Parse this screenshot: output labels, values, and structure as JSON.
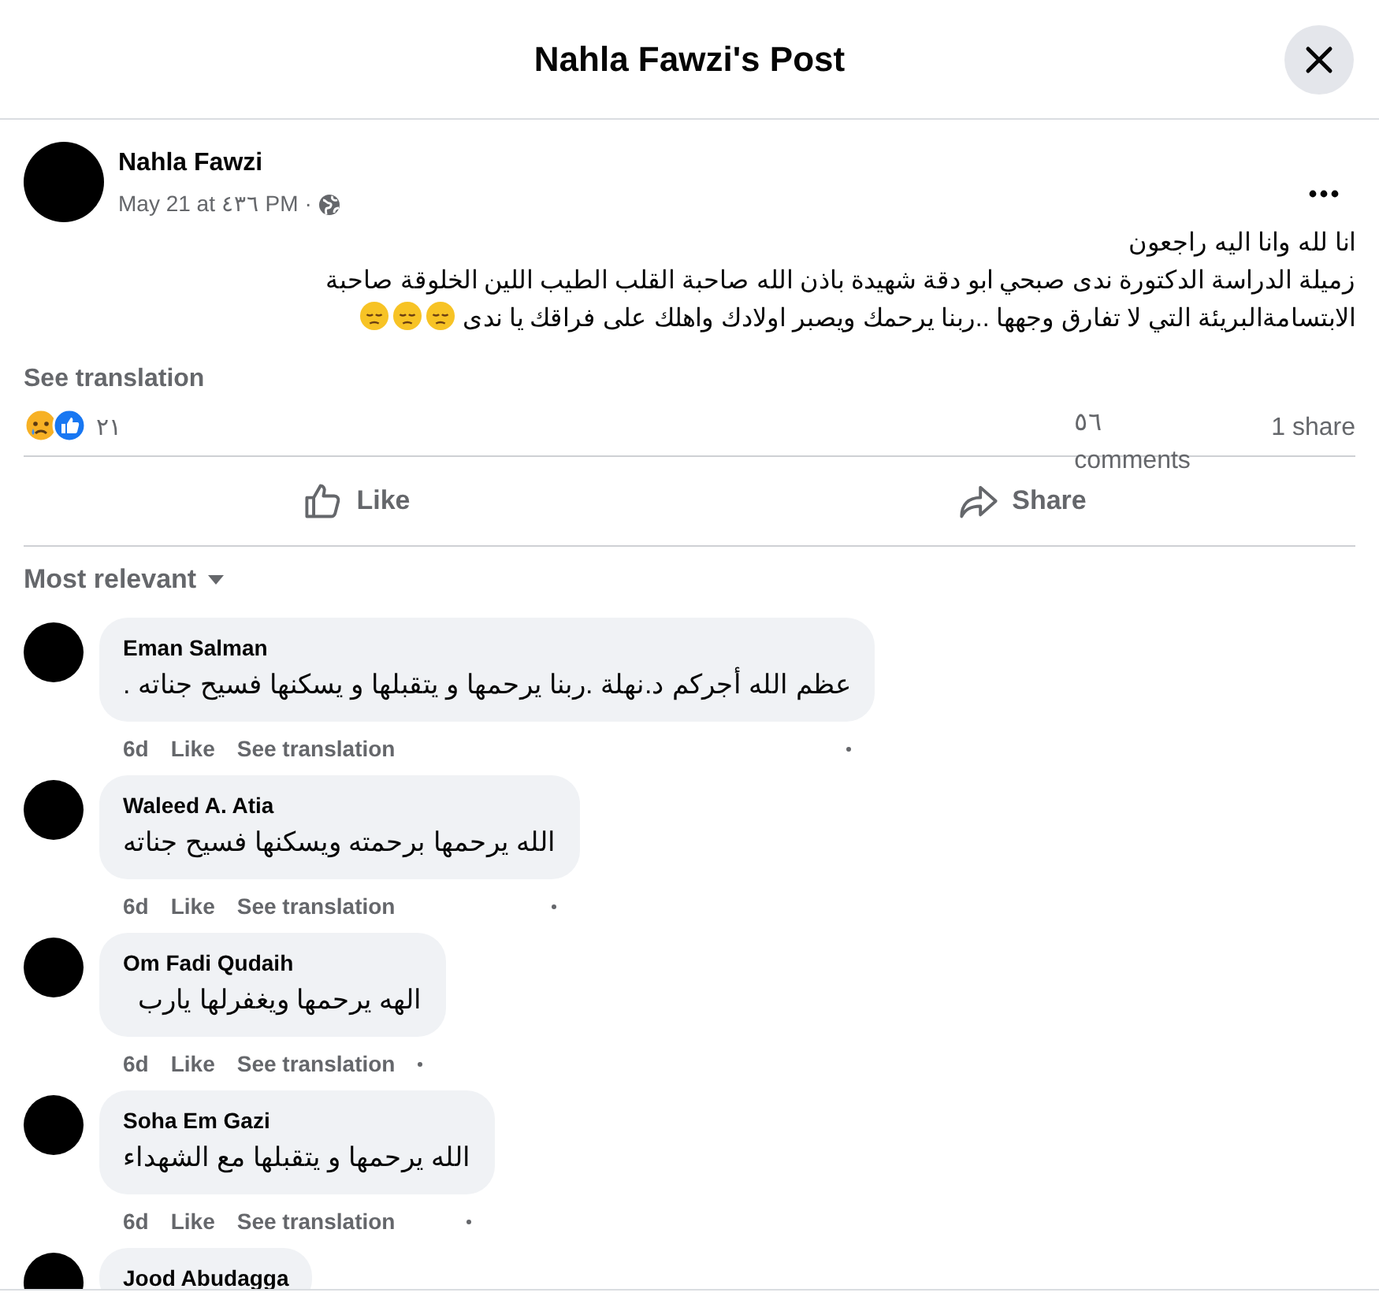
{
  "dialog": {
    "title": "Nahla Fawzi's Post"
  },
  "post": {
    "author": "Nahla Fawzi",
    "time": "May 21 at ٤٣٦ PM",
    "separator": "·",
    "paragraphs": [
      "انا لله وانا اليه راجعون",
      "زميلة الدراسة الدكتورة ندى صبحي ابو دقة شهيدة باذن الله صاحبة القلب الطيب اللين الخلوقة صاحبة الابتسامةالبريئة التي لا تفارق وجهها ..ربنا يرحمك ويصبر اولادك واهلك على فراقك يا ندى"
    ],
    "trailing_emojis": [
      {
        "kind": "pensive"
      },
      {
        "kind": "pensive"
      },
      {
        "kind": "pensive"
      }
    ],
    "see_translation": "See translation",
    "reactions": [
      {
        "kind": "sad"
      },
      {
        "kind": "like"
      }
    ],
    "reaction_count": "٢١",
    "comments_count": "٥٦ comments",
    "shares_count": "1 share",
    "like_button": {
      "kind": "like",
      "label": "Like"
    },
    "share_button": {
      "kind": "share",
      "label": "Share"
    }
  },
  "comments_filter": "Most relevant",
  "comments": [
    {
      "author": "Eman Salman",
      "text": "عظم الله أجركم د.نهلة .ربنا يرحمها و يتقبلها و يسكنها فسيح جناته .",
      "time": "6d",
      "like": "Like",
      "translate": "See translation"
    },
    {
      "author": "Waleed A. Atia",
      "text": "الله يرحمها برحمته ويسكنها فسيح جناته",
      "time": "6d",
      "like": "Like",
      "translate": "See translation"
    },
    {
      "author": "Om Fadi Qudaih",
      "text": "الهه يرحمها ويغفرلها يارب",
      "time": "6d",
      "like": "Like",
      "translate": "See translation"
    },
    {
      "author": "Soha Em Gazi",
      "text": "الله يرحمها و يتقبلها مع الشهداء",
      "time": "6d",
      "like": "Like",
      "translate": "See translation"
    },
    {
      "author": "Jood Abudagga"
    }
  ]
}
